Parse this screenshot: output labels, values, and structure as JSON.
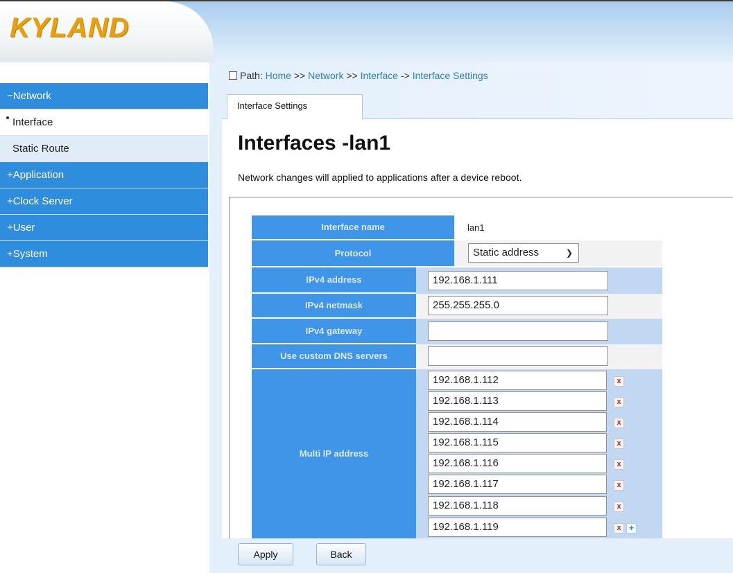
{
  "brand": {
    "logo_text": "KYLAND",
    "logo_color": "#e8a010",
    "accent": "#2f8dde"
  },
  "sidebar": {
    "items": [
      {
        "label": "−Network",
        "type": "section"
      },
      {
        "label": "Interface",
        "type": "sub",
        "active": true
      },
      {
        "label": "Static Route",
        "type": "sub"
      },
      {
        "label": "+Application",
        "type": "section"
      },
      {
        "label": "+Clock Server",
        "type": "section"
      },
      {
        "label": "+User",
        "type": "section"
      },
      {
        "label": "+System",
        "type": "section"
      }
    ]
  },
  "breadcrumb": {
    "prefix": "Path:",
    "parts": [
      "Home",
      " >> ",
      "Network",
      " >> ",
      "Interface",
      " -> ",
      "Interface Settings"
    ]
  },
  "tab": {
    "label": "Interface Settings"
  },
  "page": {
    "title": "Interfaces -lan1",
    "note": "Network changes will applied to applications after a device reboot."
  },
  "form": {
    "interface_name_label": "Interface name",
    "interface_name_value": "lan1",
    "protocol_label": "Protocol",
    "protocol_value": "Static address",
    "ipv4_address_label": "IPv4 address",
    "ipv4_address_value": "192.168.1.111",
    "ipv4_netmask_label": "IPv4 netmask",
    "ipv4_netmask_value": "255.255.255.0",
    "ipv4_gateway_label": "IPv4 gateway",
    "ipv4_gateway_value": "",
    "dns_label": "Use custom DNS servers",
    "dns_value": "",
    "multi_ip_label": "Multi IP address",
    "multi_ips": [
      "192.168.1.112",
      "192.168.1.113",
      "192.168.1.114",
      "192.168.1.115",
      "192.168.1.116",
      "192.168.1.117",
      "192.168.1.118",
      "192.168.1.119"
    ],
    "delete_icon": "x-delete-icon",
    "add_icon": "add-icon"
  },
  "buttons": {
    "apply": "Apply",
    "back": "Back"
  }
}
